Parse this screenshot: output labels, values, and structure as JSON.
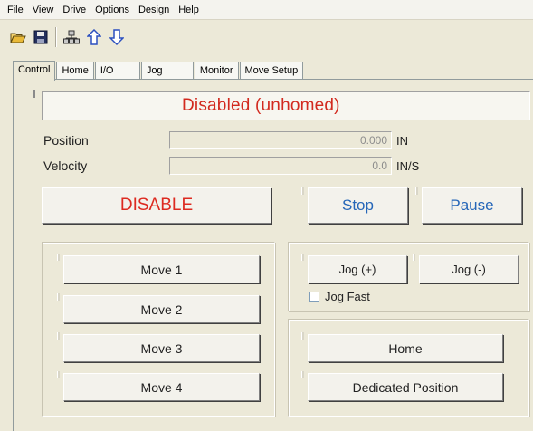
{
  "menu": [
    "File",
    "View",
    "Drive",
    "Options",
    "Design",
    "Help"
  ],
  "toolbar": {
    "buttons": [
      "open-folder-icon",
      "save-disk-icon",
      "network-drives-icon",
      "upload-arrow-icon",
      "download-arrow-icon"
    ]
  },
  "tabs": [
    {
      "label": "Control",
      "active": true
    },
    {
      "label": "Home"
    },
    {
      "label": "I/O"
    },
    {
      "label": "Jog"
    },
    {
      "label": "Monitor"
    },
    {
      "label": "Move Setup"
    }
  ],
  "status": {
    "text": "Disabled (unhomed)",
    "color": "#d22a1f"
  },
  "readouts": {
    "position": {
      "label": "Position",
      "value": "0.000",
      "unit": "IN"
    },
    "velocity": {
      "label": "Velocity",
      "value": "0.0",
      "unit": "IN/S"
    }
  },
  "controls": {
    "disable": "DISABLE",
    "stop": "Stop",
    "pause": "Pause"
  },
  "moves": [
    "Move 1",
    "Move 2",
    "Move 3",
    "Move 4"
  ],
  "jog": {
    "plus": "Jog (+)",
    "minus": "Jog (-)",
    "fast_label": "Jog Fast",
    "fast_checked": false
  },
  "homing": {
    "home": "Home",
    "dedicated": "Dedicated Position"
  },
  "colors": {
    "accent_blue": "#2566b8",
    "alert_red": "#dd2a20"
  }
}
